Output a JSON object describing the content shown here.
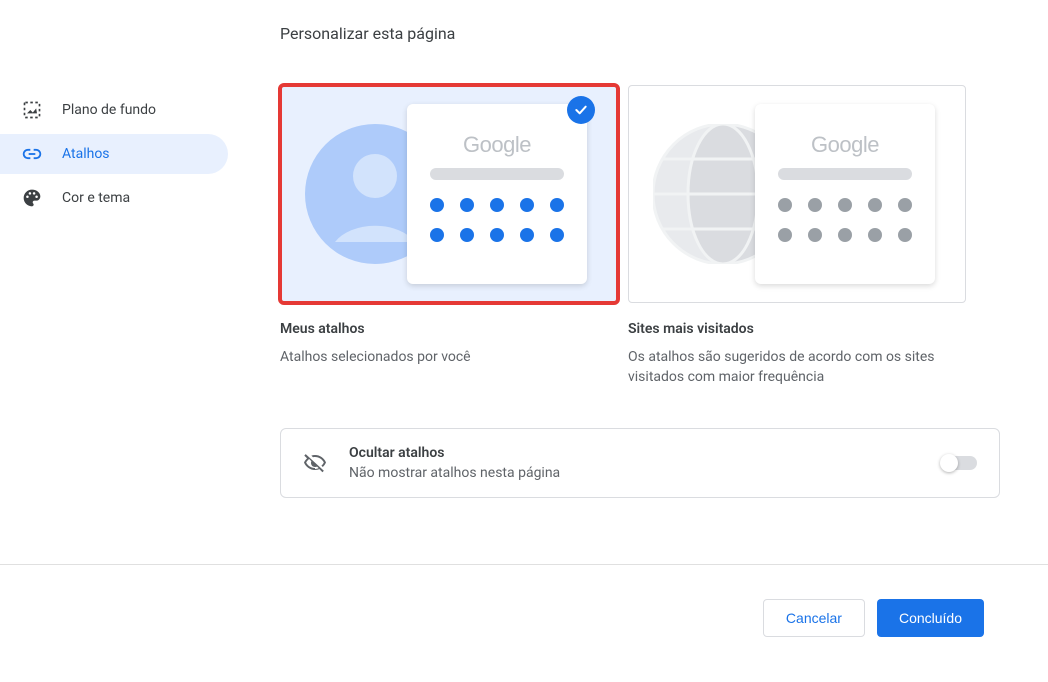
{
  "page_title": "Personalizar esta página",
  "sidebar": {
    "items": [
      {
        "label": "Plano de fundo"
      },
      {
        "label": "Atalhos"
      },
      {
        "label": "Cor e tema"
      }
    ]
  },
  "options": {
    "my_shortcuts": {
      "title": "Meus atalhos",
      "description": "Atalhos selecionados por você",
      "logo_text": "Google"
    },
    "most_visited": {
      "title": "Sites mais visitados",
      "description": "Os atalhos são sugeridos de acordo com os sites visitados com maior frequência",
      "logo_text": "Google"
    }
  },
  "hide_section": {
    "title": "Ocultar atalhos",
    "description": "Não mostrar atalhos nesta página"
  },
  "footer": {
    "cancel_label": "Cancelar",
    "done_label": "Concluído"
  }
}
